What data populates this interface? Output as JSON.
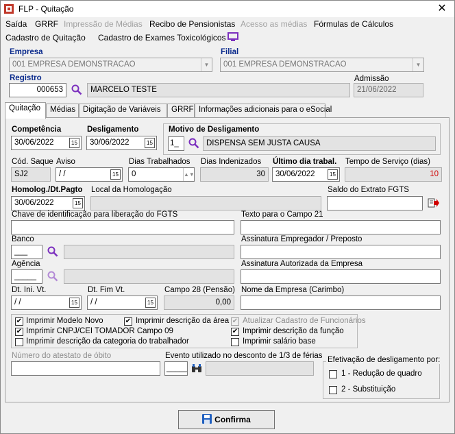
{
  "window": {
    "title": "FLP - Quitação"
  },
  "menu": {
    "row1": [
      "Saída",
      "GRRF",
      "Impressão de Médias",
      "Recibo de Pensionistas",
      "Acesso as médias",
      "Fórmulas de Cálculos"
    ],
    "row2": [
      "Cadastro de Quitação",
      "Cadastro de Exames Toxicológicos"
    ]
  },
  "header": {
    "empresa_label": "Empresa",
    "empresa_value": "001 EMPRESA DEMONSTRACAO",
    "filial_label": "Filial",
    "filial_value": "001 EMPRESA DEMONSTRACAO",
    "registro_label": "Registro",
    "registro_value": "000653",
    "nome_value": "MARCELO TESTE",
    "admissao_label": "Admissão",
    "admissao_value": "21/06/2022"
  },
  "tabs": [
    "Quitação",
    "Médias",
    "Digitação de Variáveis",
    "GRRF",
    "Informações adicionais para o eSocial"
  ],
  "quitacao": {
    "competencia_label": "Competência",
    "competencia_value": "30/06/2022",
    "desligamento_label": "Desligamento",
    "desligamento_value": "30/06/2022",
    "motivo_label": "Motivo de Desligamento",
    "motivo_code": "1_",
    "motivo_desc": "DISPENSA SEM JUSTA CAUSA",
    "cod_saque_label": "Cód. Saque",
    "cod_saque_value": "SJ2",
    "aviso_label": "Aviso",
    "aviso_value": " / /",
    "dias_trab_label": "Dias Trabalhados",
    "dias_trab_value": "0",
    "dias_indenizados_label": "Dias Indenizados",
    "dias_indenizados_value": "30",
    "ultimo_dia_label": "Último dia trabal.",
    "ultimo_dia_value": "30/06/2022",
    "tempo_servico_label": "Tempo de Serviço (dias)",
    "tempo_servico_value": "10",
    "homolog_label": "Homolog./Dt.Pagto",
    "homolog_value": "30/06/2022",
    "local_homolog_label": "Local da Homologação",
    "saldo_fgts_label": "Saldo do Extrato FGTS",
    "chave_label": "Chave de identificação para liberação do FGTS",
    "texto21_label": "Texto para o Campo 21",
    "banco_label": "Banco",
    "banco_value": "___",
    "assin_emp_label": "Assinatura Empregador / Preposto",
    "agencia_label": "Agência",
    "agencia_value": "_____",
    "assin_aut_label": "Assinatura Autorizada da Empresa",
    "dt_ini_label": "Dt. Ini. Vt.",
    "dt_ini_value": " / /",
    "dt_fim_label": "Dt. Fim Vt.",
    "dt_fim_value": " / /",
    "campo28_label": "Campo 28 (Pensão)",
    "campo28_value": "0,00",
    "nome_empresa_label": "Nome da Empresa (Carimbo)",
    "chk_modelo_novo": "Imprimir Modelo Novo",
    "chk_desc_area": "Imprimir descrição da área",
    "chk_atualizar": "Atualizar Cadastro de Funcionários",
    "chk_cnpj": "Imprimir CNPJ/CEI TOMADOR Campo 09",
    "chk_desc_funcao": "Imprimir descrição da função",
    "chk_desc_categoria": "Imprimir descrição da categoria do trabalhador",
    "chk_salario_base": "Imprimir salário base",
    "atestado_label": "Número do atestato de óbito",
    "evento_label": "Evento utilizado no desconto de 1/3 de férias",
    "evento_value": "_____",
    "efetivacao_label": "Efetivação de desligamento por:",
    "efet_opt1": "1 - Redução de quadro",
    "efet_opt2": "2 - Substituição"
  },
  "footer": {
    "confirm_label": "Confirma"
  },
  "colors": {
    "accent": "#7b2fbe",
    "label_blue": "#0a2a8c",
    "red_value": "#d00000"
  }
}
